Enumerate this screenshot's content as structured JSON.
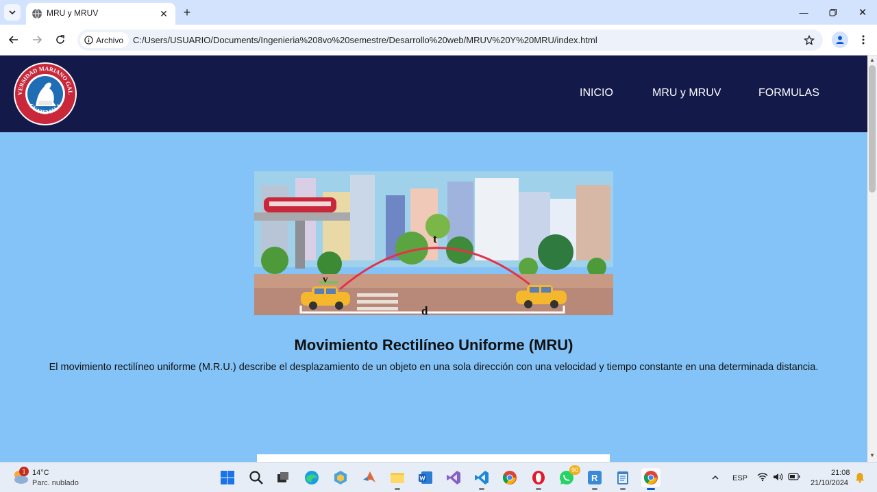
{
  "browser": {
    "tab_title": "MRU y MRUV",
    "chip_label": "Archivo",
    "url": "C:/Users/USUARIO/Documents/Ingenieria%208vo%20semestre/Desarrollo%20web/MRUV%20Y%20MRU/index.html",
    "icons": [
      "tab-search-icon",
      "globe-icon",
      "close-icon",
      "plus-icon",
      "minimize-icon",
      "restore-icon",
      "back-icon",
      "forward-icon",
      "reload-icon",
      "info-icon",
      "star-icon",
      "profile-icon",
      "kebab-menu-icon"
    ]
  },
  "site": {
    "logo_text_top": "UNIVERSIDAD MARIANO GALVEZ",
    "logo_text_bottom": "GUATEMALA",
    "nav": [
      {
        "label": "INICIO"
      },
      {
        "label": "MRU y MRUV"
      },
      {
        "label": "FORMULAS"
      }
    ],
    "hero_labels": {
      "t": "t",
      "v": "v",
      "d": "d"
    },
    "title": "Movimiento Rectilíneo Uniforme (MRU)",
    "description": "El movimiento rectilíneo uniforme (M.R.U.) describe el desplazamiento de un objeto en una sola dirección con una velocidad y tiempo constante en una determinada distancia.",
    "colors": {
      "header_bg": "#131a4a",
      "page_bg": "#83c3f7",
      "arc": "#e2334a"
    }
  },
  "taskbar": {
    "weather_temp": "14°C",
    "weather_desc": "Parc. nublado",
    "weather_badge": "1",
    "whatsapp_badge": "90",
    "language": "ESP",
    "time": "21:08",
    "date": "21/10/2024",
    "icons": [
      "windows-start-icon",
      "search-icon",
      "task-view-icon",
      "edge-icon",
      "app-icon",
      "matlab-icon",
      "file-explorer-icon",
      "word-icon",
      "visual-studio-icon",
      "vscode-icon",
      "chrome-icon",
      "opera-icon",
      "whatsapp-icon",
      "rstudio-icon",
      "notepad-icon",
      "chrome-active-icon"
    ]
  }
}
